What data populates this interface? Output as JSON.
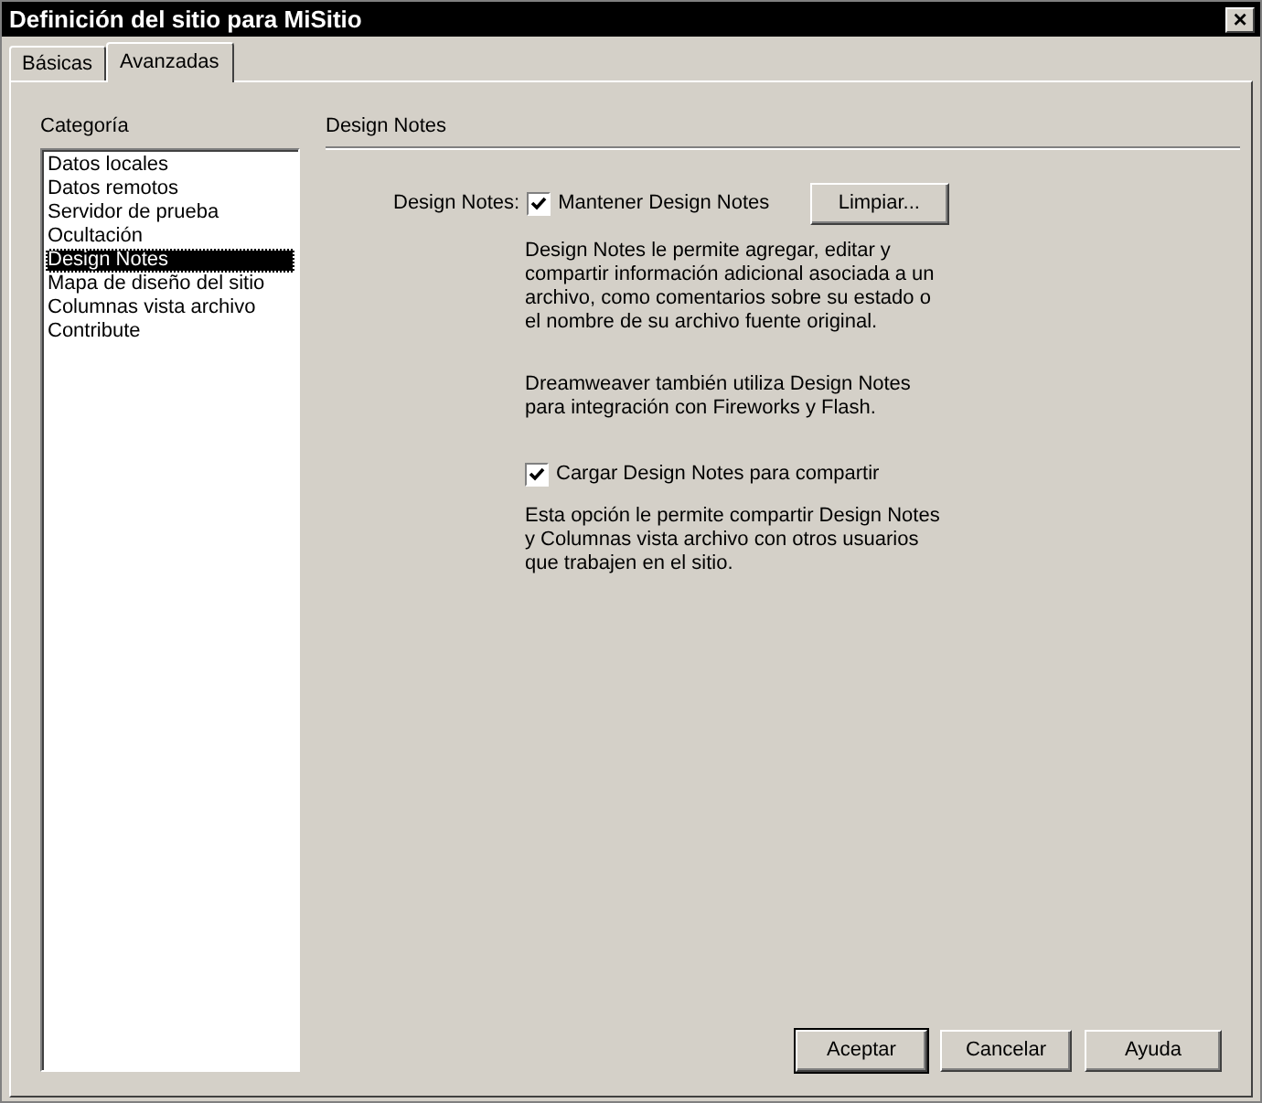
{
  "window": {
    "title": "Definición del sitio para MiSitio",
    "close": "×"
  },
  "tabs": [
    {
      "label": "Básicas",
      "selected": false
    },
    {
      "label": "Avanzadas",
      "selected": true
    }
  ],
  "category": {
    "label": "Categoría",
    "items": [
      {
        "label": "Datos locales",
        "selected": false
      },
      {
        "label": "Datos remotos",
        "selected": false
      },
      {
        "label": "Servidor de prueba",
        "selected": false
      },
      {
        "label": "Ocultación",
        "selected": false
      },
      {
        "label": "Design Notes",
        "selected": true
      },
      {
        "label": "Mapa de diseño del sitio",
        "selected": false
      },
      {
        "label": "Columnas vista archivo",
        "selected": false
      },
      {
        "label": "Contribute",
        "selected": false
      }
    ]
  },
  "section": {
    "title": "Design Notes",
    "field_label": "Design Notes:",
    "maintain": {
      "label": "Mantener Design Notes",
      "checked": true
    },
    "clean_button": "Limpiar...",
    "description_1": "Design Notes le permite agregar, editar y compartir información adicional asociada a un archivo, como comentarios sobre su estado o el nombre de su archivo fuente original.",
    "description_2": "Dreamweaver también utiliza Design Notes para integración con Fireworks y Flash.",
    "upload": {
      "label": "Cargar Design Notes para compartir",
      "checked": true
    },
    "description_3": "Esta opción le permite compartir Design Notes y Columnas vista archivo con otros usuarios que trabajen en el sitio."
  },
  "buttons": [
    {
      "label": "Aceptar",
      "default": true
    },
    {
      "label": "Cancelar",
      "default": false
    },
    {
      "label": "Ayuda",
      "default": false
    }
  ]
}
